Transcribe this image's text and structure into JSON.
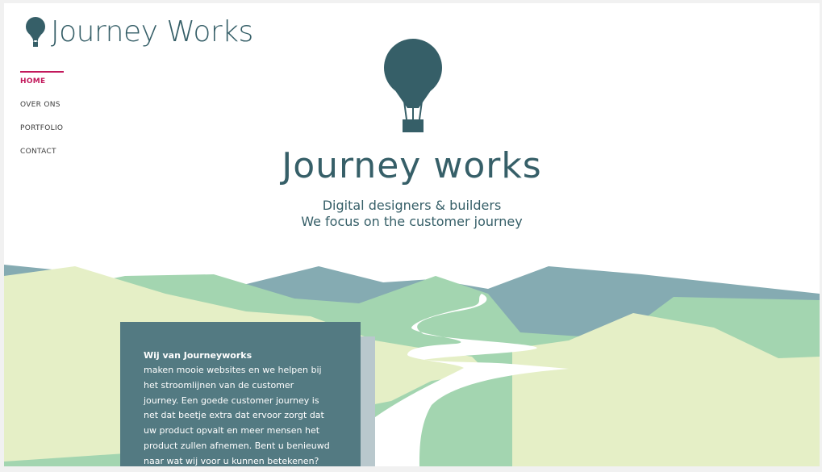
{
  "header": {
    "brand_name": "Journey Works",
    "logo_icon": "hot-air-balloon-icon"
  },
  "nav": {
    "items": [
      {
        "label": "HOME",
        "active": true
      },
      {
        "label": "OVER ONS",
        "active": false
      },
      {
        "label": "PORTFOLIO",
        "active": false
      },
      {
        "label": "CONTACT",
        "active": false
      }
    ]
  },
  "hero": {
    "icon": "hot-air-balloon-icon",
    "title": "Journey works",
    "subtitle_line1": "Digital designers & builders",
    "subtitle_line2": "We focus on the customer journey"
  },
  "intro": {
    "title": "Wij van Journeyworks",
    "body": "maken mooie websites en we helpen bij\nhet stroomlijnen van de customer\njourney. Een goede customer journey is\nnet dat beetje extra dat ervoor zorgt dat\nuw product opvalt en meer mensen het\nproduct zullen afnemen. Bent u benieuwd\nnaar wat wij voor u kunnen betekenen?"
  },
  "colors": {
    "brand": "#365f68",
    "accent": "#c2185b",
    "card": "#537a82",
    "mountain_far": "#85abb2",
    "hill_mid": "#a3d5b0",
    "hill_front": "#e5efc6"
  }
}
